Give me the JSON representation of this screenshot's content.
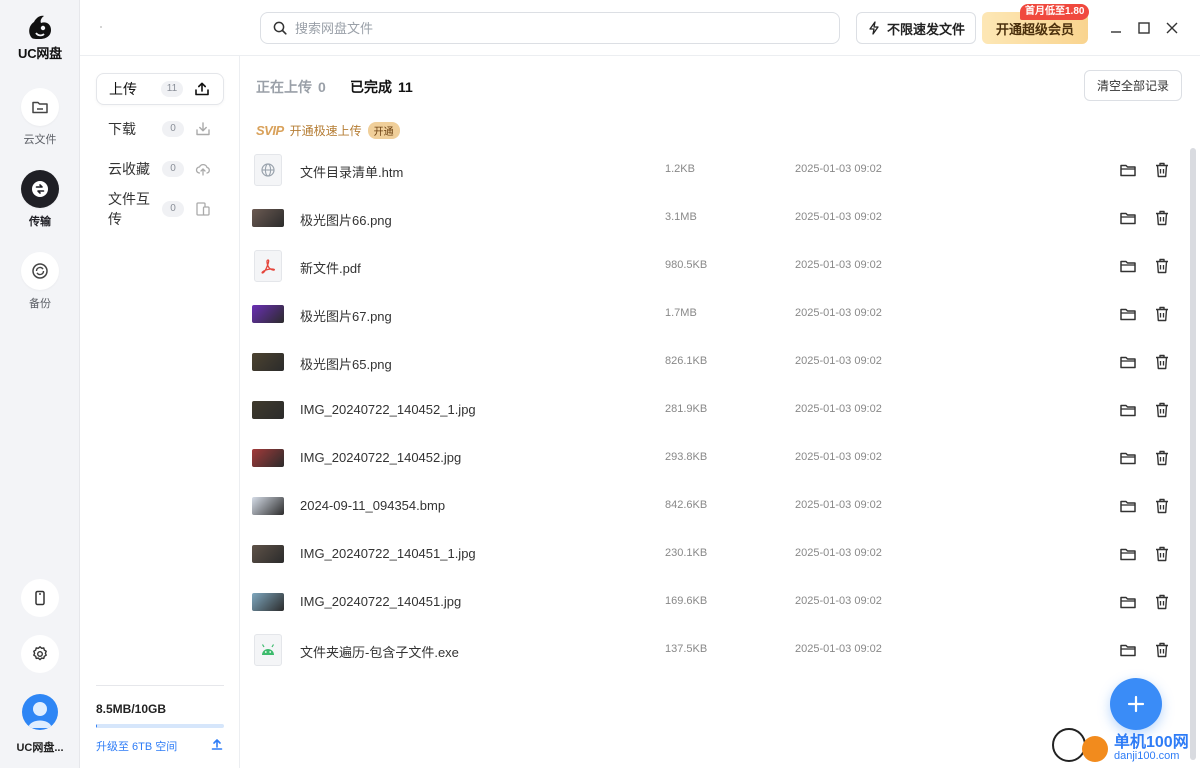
{
  "app": {
    "logo_text": "UC网盘"
  },
  "rail": {
    "items": [
      {
        "label": "云文件",
        "icon": "folder-icon"
      },
      {
        "label": "传输",
        "icon": "transfer-icon"
      },
      {
        "label": "备份",
        "icon": "backup-icon"
      }
    ],
    "bottom": {
      "phone_icon": "phone-icon",
      "settings_icon": "gear-icon",
      "user_name": "UC网盘..."
    }
  },
  "topbar": {
    "search_placeholder": "搜索网盘文件",
    "speed_label": "不限速发文件",
    "vip_label": "开通超级会员",
    "vip_badge": "首月低至1.80"
  },
  "subnav": {
    "items": [
      {
        "label": "上传",
        "count": "11",
        "icon": "upload-icon"
      },
      {
        "label": "下载",
        "count": "0",
        "icon": "download-icon"
      },
      {
        "label": "云收藏",
        "count": "0",
        "icon": "cloud-save-icon"
      },
      {
        "label": "文件互传",
        "count": "0",
        "icon": "devices-icon"
      }
    ],
    "storage": {
      "used_text": "8.5MB/10GB",
      "used_fraction": 0.00085,
      "upgrade_text": "升级至 6TB 空间"
    }
  },
  "main": {
    "tabs": [
      {
        "label": "正在上传",
        "count": "0"
      },
      {
        "label": "已完成",
        "count": "11"
      }
    ],
    "clear_label": "清空全部记录",
    "svip": {
      "logo": "SVIP",
      "text": "开通极速上传",
      "button": "开通"
    },
    "files": [
      {
        "name": "文件目录清单.htm",
        "size": "1.2KB",
        "time": "2025-01-03 09:02",
        "type": "htm"
      },
      {
        "name": "极光图片66.png",
        "size": "3.1MB",
        "time": "2025-01-03 09:02",
        "type": "img",
        "thumb": "#6b5a52"
      },
      {
        "name": "新文件.pdf",
        "size": "980.5KB",
        "time": "2025-01-03 09:02",
        "type": "pdf"
      },
      {
        "name": "极光图片67.png",
        "size": "1.7MB",
        "time": "2025-01-03 09:02",
        "type": "img",
        "thumb": "#6a2fb5"
      },
      {
        "name": "极光图片65.png",
        "size": "826.1KB",
        "time": "2025-01-03 09:02",
        "type": "img",
        "thumb": "#4c4330"
      },
      {
        "name": "IMG_20240722_140452_1.jpg",
        "size": "281.9KB",
        "time": "2025-01-03 09:02",
        "type": "img",
        "thumb": "#3f3a2c"
      },
      {
        "name": "IMG_20240722_140452.jpg",
        "size": "293.8KB",
        "time": "2025-01-03 09:02",
        "type": "img",
        "thumb": "#a33a3a"
      },
      {
        "name": "2024-09-11_094354.bmp",
        "size": "842.6KB",
        "time": "2025-01-03 09:02",
        "type": "img",
        "thumb": "#d6dde8"
      },
      {
        "name": "IMG_20240722_140451_1.jpg",
        "size": "230.1KB",
        "time": "2025-01-03 09:02",
        "type": "img",
        "thumb": "#5e5248"
      },
      {
        "name": "IMG_20240722_140451.jpg",
        "size": "169.6KB",
        "time": "2025-01-03 09:02",
        "type": "img",
        "thumb": "#7fa8bf"
      },
      {
        "name": "文件夹遍历-包含子文件.exe",
        "size": "137.5KB",
        "time": "2025-01-03 09:02",
        "type": "exe"
      }
    ],
    "fab_icon": "plus-icon"
  },
  "watermark": {
    "line1": "单机100网",
    "line2": "danji100.com"
  },
  "colors": {
    "accent": "#2e7cf6",
    "rail_bg": "#f3f4f7",
    "active_dark": "#1f1f25",
    "vip_gold": "#f9d48f",
    "badge_red": "#f0493e"
  }
}
